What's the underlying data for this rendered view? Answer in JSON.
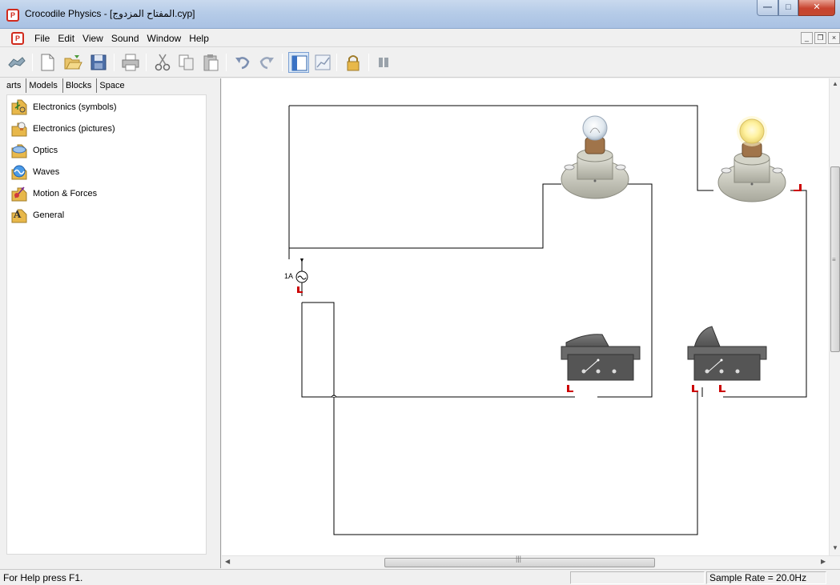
{
  "window": {
    "title": "Crocodile Physics - [المفتاح المزدوج.cyp]"
  },
  "menu": {
    "items": [
      "File",
      "Edit",
      "View",
      "Sound",
      "Window",
      "Help"
    ]
  },
  "toolbar": {
    "buttons": [
      "run-icon",
      "new-icon",
      "open-icon",
      "save-icon",
      "print-icon",
      "cut-icon",
      "copy-icon",
      "paste-icon",
      "undo-icon",
      "redo-icon",
      "parts-panel-icon",
      "graph-icon",
      "lock-icon",
      "pause-icon"
    ]
  },
  "left_panel": {
    "tabs": [
      "arts",
      "Models",
      "Blocks",
      "Space"
    ],
    "tree_items": [
      {
        "label": "Electronics (symbols)",
        "icon": "electronics-symbols-icon"
      },
      {
        "label": "Electronics (pictures)",
        "icon": "electronics-pictures-icon"
      },
      {
        "label": "Optics",
        "icon": "optics-icon"
      },
      {
        "label": "Waves",
        "icon": "waves-icon"
      },
      {
        "label": "Motion & Forces",
        "icon": "motion-forces-icon"
      },
      {
        "label": "General",
        "icon": "general-icon"
      }
    ]
  },
  "circuit": {
    "source_label": "1A",
    "bulbs": [
      {
        "name": "bulb-left",
        "state": "off"
      },
      {
        "name": "bulb-right",
        "state": "on"
      }
    ],
    "switches": [
      {
        "name": "switch-left"
      },
      {
        "name": "switch-right"
      }
    ]
  },
  "statusbar": {
    "help_text": "For Help press F1.",
    "sample_rate": "Sample Rate =  20.0Hz"
  },
  "colors": {
    "wire": "#000000",
    "terminal": "#cc0000",
    "bulb_on": "#fff2a0",
    "switch_body": "#5a5a5a"
  }
}
